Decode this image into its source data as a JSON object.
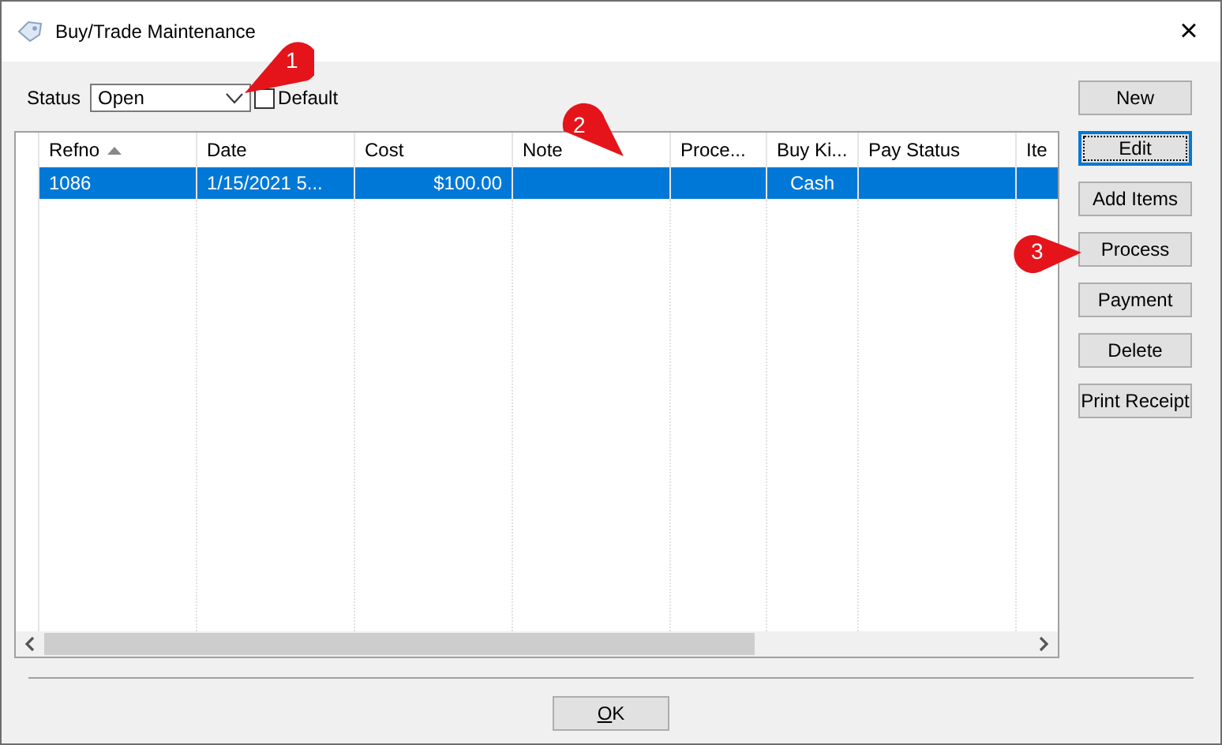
{
  "window": {
    "title": "Buy/Trade Maintenance",
    "close": "×"
  },
  "filter": {
    "label": "Status",
    "value": "Open",
    "default_label": "Default",
    "default_checked": false
  },
  "table": {
    "columns": [
      {
        "label": "Refno",
        "sorted": true
      },
      {
        "label": "Date",
        "sorted": false
      },
      {
        "label": "Cost",
        "sorted": false
      },
      {
        "label": "Note",
        "sorted": false
      },
      {
        "label": "Proce...",
        "sorted": false
      },
      {
        "label": "Buy Ki...",
        "sorted": false
      },
      {
        "label": "Pay Status",
        "sorted": false
      },
      {
        "label": "Ite",
        "sorted": false
      }
    ],
    "rows": [
      {
        "selected": true,
        "cells": [
          "1086",
          "1/15/2021 5...",
          "$100.00",
          "",
          "",
          "Cash",
          "",
          ""
        ]
      }
    ]
  },
  "buttons": [
    {
      "label": "New",
      "focused": false
    },
    {
      "label": "Edit",
      "focused": true
    },
    {
      "label": "Add Items",
      "focused": false
    },
    {
      "label": "Process",
      "focused": false
    },
    {
      "label": "Payment",
      "focused": false
    },
    {
      "label": "Delete",
      "focused": false
    },
    {
      "label": "Print Receipt",
      "focused": false
    }
  ],
  "ok_button": "OK",
  "callouts": [
    "1",
    "2",
    "3"
  ]
}
